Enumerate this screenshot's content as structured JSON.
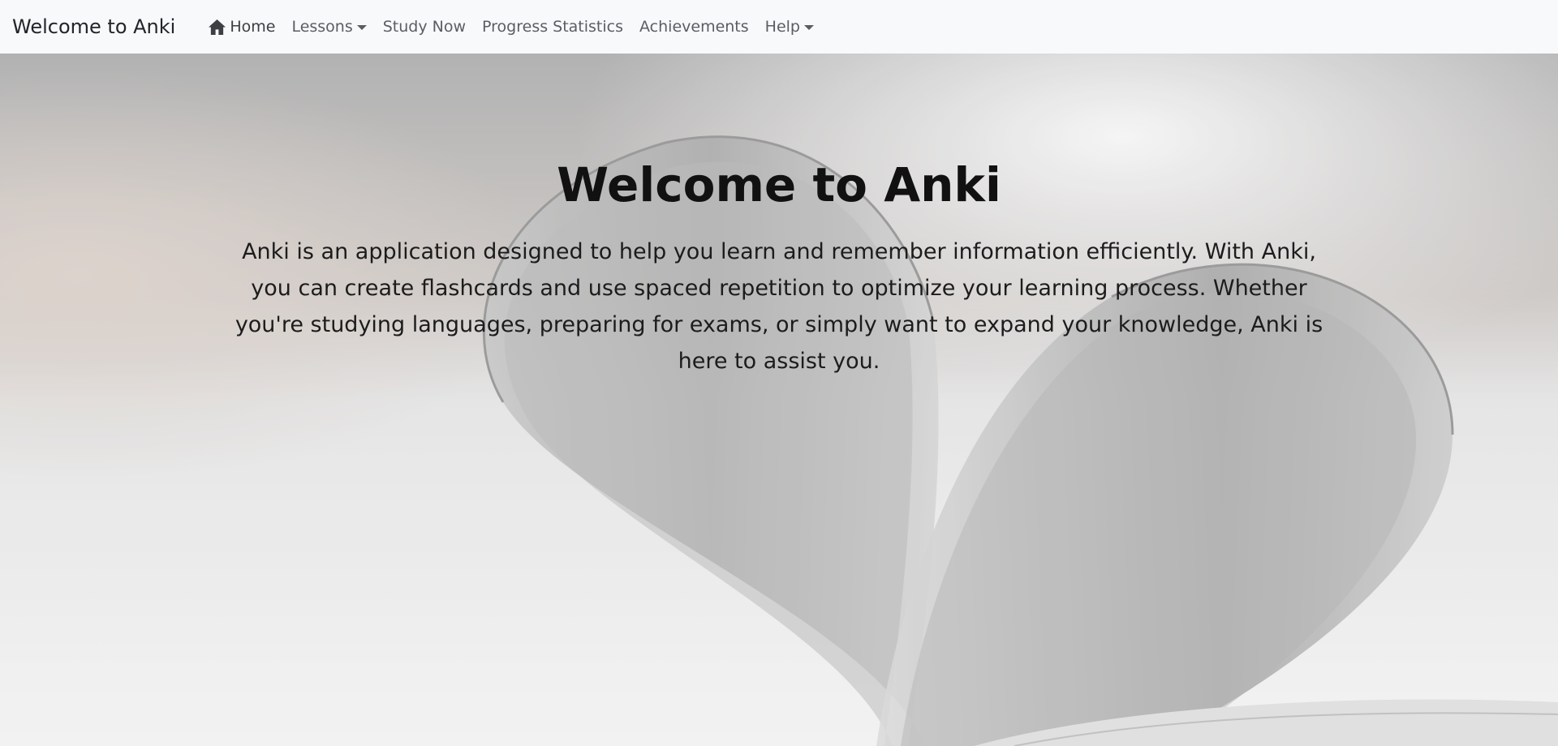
{
  "navbar": {
    "brand": "Welcome to Anki",
    "items": [
      {
        "label": "Home",
        "icon": "home-icon",
        "active": true
      },
      {
        "label": "Lessons",
        "dropdown": true
      },
      {
        "label": "Study Now"
      },
      {
        "label": "Progress Statistics"
      },
      {
        "label": "Achievements"
      },
      {
        "label": "Help",
        "dropdown": true
      }
    ]
  },
  "hero": {
    "title": "Welcome to Anki",
    "description": "Anki is an application designed to help you learn and remember information efficiently. With Anki, you can create flashcards and use spaced repetition to optimize your learning process. Whether you're studying languages, preparing for exams, or simply want to expand your knowledge, Anki is here to assist you.",
    "background_image": "book-pages-heart-image"
  },
  "colors": {
    "navbar_bg": "#f8f9fa",
    "brand_text": "#212529",
    "nav_text": "#5a5e63",
    "hero_title": "#111111"
  }
}
